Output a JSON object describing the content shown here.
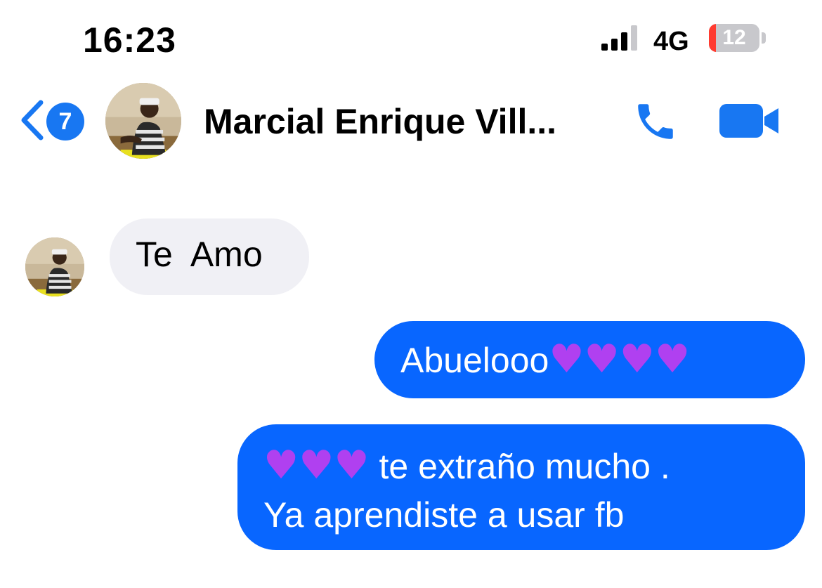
{
  "status_bar": {
    "time": "16:23",
    "network": "4G",
    "battery": "12"
  },
  "header": {
    "unread_count": "7",
    "contact_name": "Marcial Enrique Vill..."
  },
  "messages": [
    {
      "direction": "incoming",
      "text": "Te  Amo"
    },
    {
      "direction": "outgoing",
      "text": "Abuelooo💜💜💜💜"
    },
    {
      "direction": "outgoing",
      "text": "💜💜💜 te extraño mucho .\nYa aprendiste a usar fb"
    }
  ],
  "colors": {
    "accent": "#0866ff",
    "incoming_bubble": "#f0f0f5",
    "heart": "#b040f0",
    "battery_low": "#ff3b30"
  }
}
